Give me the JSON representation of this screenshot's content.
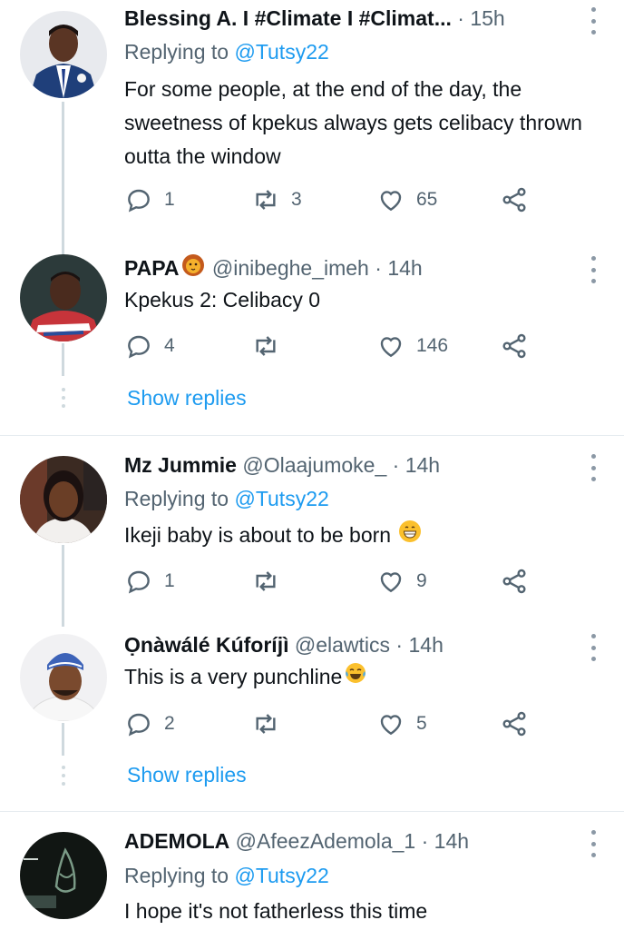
{
  "tweets": [
    {
      "name": "Blessing A. I #Climate I #Climat...",
      "handle": "",
      "time": "15h",
      "replying_label": "Replying to ",
      "replying_to": "@Tutsy22",
      "text": "For some people, at the end of the day, the sweetness of kpekus always gets celibacy thrown outta the window",
      "replies": "1",
      "retweets": "3",
      "likes": "65"
    },
    {
      "name": "PAPA",
      "handle": "@inibeghe_imeh",
      "time": "14h",
      "text": "Kpekus 2: Celibacy 0",
      "replies": "4",
      "retweets": "",
      "likes": "146"
    },
    {
      "name": "Mz Jummie",
      "handle": "@Olaajumoke_",
      "time": "14h",
      "replying_label": "Replying to ",
      "replying_to": "@Tutsy22",
      "text": "Ikeji baby is about to be born",
      "replies": "1",
      "retweets": "",
      "likes": "9"
    },
    {
      "name": "Ọnàwálé Kúforíjì",
      "handle": "@elawtics",
      "time": "14h",
      "text": "This is a very punchline",
      "replies": "2",
      "retweets": "",
      "likes": "5"
    },
    {
      "name": "ADEMOLA",
      "handle": "@AfeezAdemola_1",
      "time": "14h",
      "replying_label": "Replying to ",
      "replying_to": "@Tutsy22",
      "text": "I hope it's not fatherless this time"
    }
  ],
  "show_replies": "Show replies",
  "dot": "·",
  "colors": {
    "link": "#1d9bf0",
    "secondary": "#536471",
    "line": "#cfd9de"
  },
  "icons": [
    "reply-icon",
    "retweet-icon",
    "like-icon",
    "share-icon",
    "more-icon"
  ]
}
